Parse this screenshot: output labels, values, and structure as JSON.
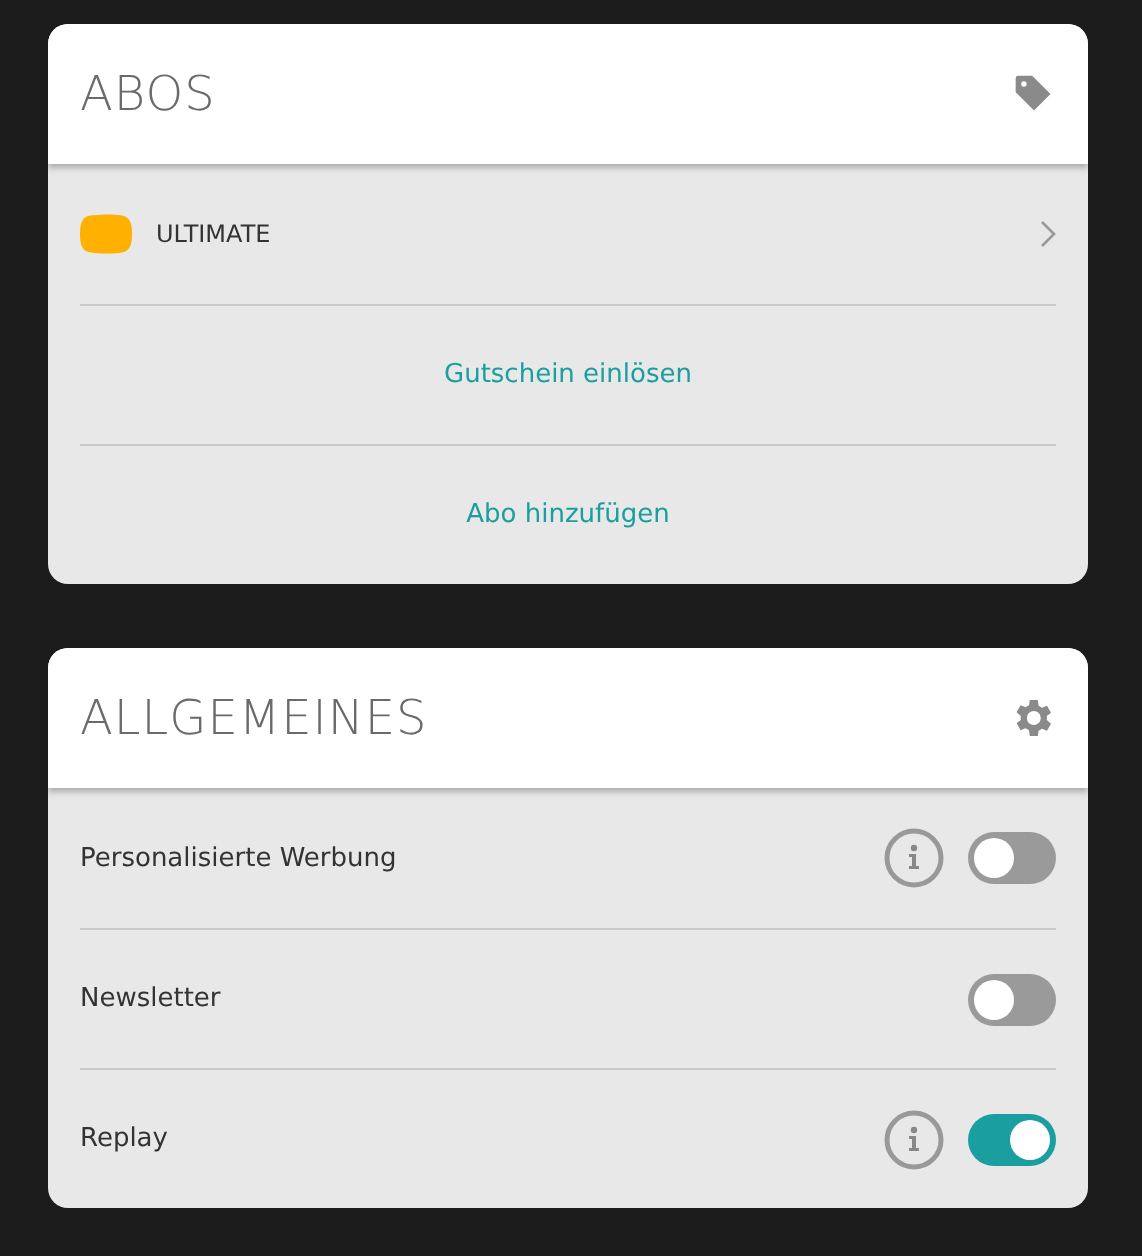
{
  "subscriptions": {
    "title": "ABOS",
    "plan": {
      "name": "ULTIMATE",
      "color": "#ffb000"
    },
    "links": [
      "Gutschein einlösen",
      "Abo hinzufügen"
    ]
  },
  "general": {
    "title": "ALLGEMEINES",
    "settings": [
      {
        "label": "Personalisierte Werbung",
        "info": true,
        "on": false
      },
      {
        "label": "Newsletter",
        "info": false,
        "on": false
      },
      {
        "label": "Replay",
        "info": true,
        "on": true
      }
    ]
  }
}
